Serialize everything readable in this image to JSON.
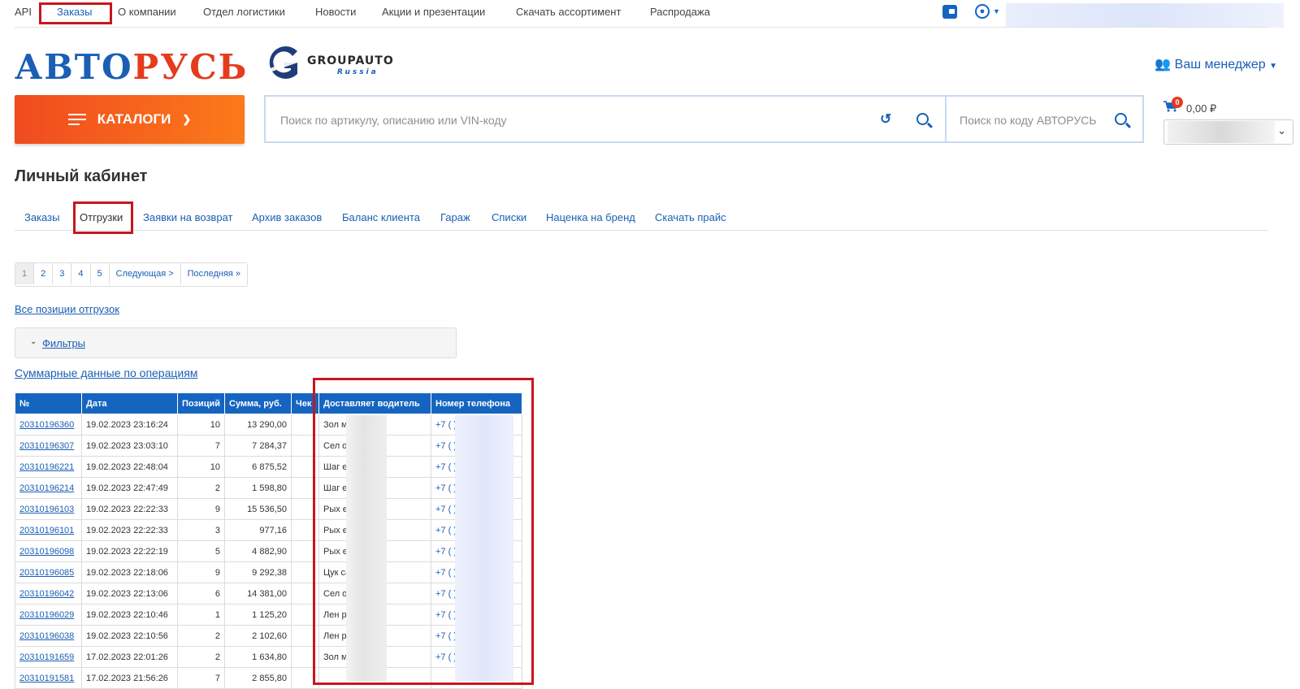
{
  "topnav": {
    "items": [
      "API",
      "Заказы",
      "О компании",
      "Отдел логистики",
      "Новости",
      "Акции и презентации",
      "Скачать ассортимент",
      "Распродажа"
    ]
  },
  "header": {
    "logo_part1": "АВТО",
    "logo_part2": "РУСЬ",
    "partner_name": "GROUPAUTO",
    "partner_sub": "Russia",
    "manager_label": "Ваш менеджер"
  },
  "search": {
    "catalog_label": "КАТАЛОГИ",
    "main_placeholder": "Поиск по артикулу, описанию или VIN-коду",
    "code_placeholder": "Поиск по коду АВТОРУСЬ"
  },
  "cart": {
    "count": "0",
    "total": "0,00 ₽"
  },
  "cabinet": {
    "title": "Личный кабинет",
    "tabs": [
      "Заказы",
      "Отгрузки",
      "Заявки на возврат",
      "Архив заказов",
      "Баланс клиента",
      "Гараж",
      "Списки",
      "Наценка на бренд",
      "Скачать прайс"
    ]
  },
  "pagination": [
    "1",
    "2",
    "3",
    "4",
    "5",
    "Следующая >",
    "Последняя »"
  ],
  "links": {
    "all_positions": "Все позиции отгрузок",
    "filters": "Фильтры",
    "summary": "Суммарные данные по операциям"
  },
  "table": {
    "headers": [
      "№",
      "Дата",
      "Позиций",
      "Сумма, руб.",
      "Чек",
      "Доставляет водитель",
      "Номер телефона"
    ],
    "rows": [
      [
        "20310196360",
        "19.02.2023 23:16:24",
        "10",
        "13 290,00",
        "",
        "Зол          ман",
        "+7 (          )6"
      ],
      [
        "20310196307",
        "19.02.2023 23:03:10",
        "7",
        "7 284,37",
        "",
        "Сел          оман",
        "+7 (          )0"
      ],
      [
        "20310196221",
        "19.02.2023 22:48:04",
        "10",
        "6 875,52",
        "",
        "Шаг          ей",
        "+7 (          )3"
      ],
      [
        "20310196214",
        "19.02.2023 22:47:49",
        "2",
        "1 598,80",
        "",
        "Шаг          ей",
        "+7 (          )3"
      ],
      [
        "20310196103",
        "19.02.2023 22:22:33",
        "9",
        "15 536,50",
        "",
        "Рых          ей",
        "+7 (          )8"
      ],
      [
        "20310196101",
        "19.02.2023 22:22:33",
        "3",
        "977,16",
        "",
        "Рых          ей",
        "+7 (          )8"
      ],
      [
        "20310196098",
        "19.02.2023 22:22:19",
        "5",
        "4 882,90",
        "",
        "Рых          ей",
        "+7 (          )8"
      ],
      [
        "20310196085",
        "19.02.2023 22:18:06",
        "9",
        "9 292,38",
        "",
        "Цук          сандр",
        "+7 (          )0"
      ],
      [
        "20310196042",
        "19.02.2023 22:13:06",
        "6",
        "14 381,00",
        "",
        "Сел          оман",
        "+7 (          )0"
      ],
      [
        "20310196029",
        "19.02.2023 22:10:46",
        "1",
        "1 125,20",
        "",
        "Лен          рей",
        "+7 (          )7"
      ],
      [
        "20310196038",
        "19.02.2023 22:10:56",
        "2",
        "2 102,60",
        "",
        "Лен          рей",
        "+7 (          )7"
      ],
      [
        "20310191659",
        "17.02.2023 22:01:26",
        "2",
        "1 634,80",
        "",
        "Зол          ман",
        "+7 (          )6"
      ],
      [
        "20310191581",
        "17.02.2023 21:56:26",
        "7",
        "2 855,80",
        "",
        "",
        ""
      ]
    ]
  },
  "colors": {
    "primary_blue": "#1565c0",
    "brand_orange": "#f04b1f",
    "logo_red": "#e53b1e",
    "highlight_red": "#c8161d"
  }
}
